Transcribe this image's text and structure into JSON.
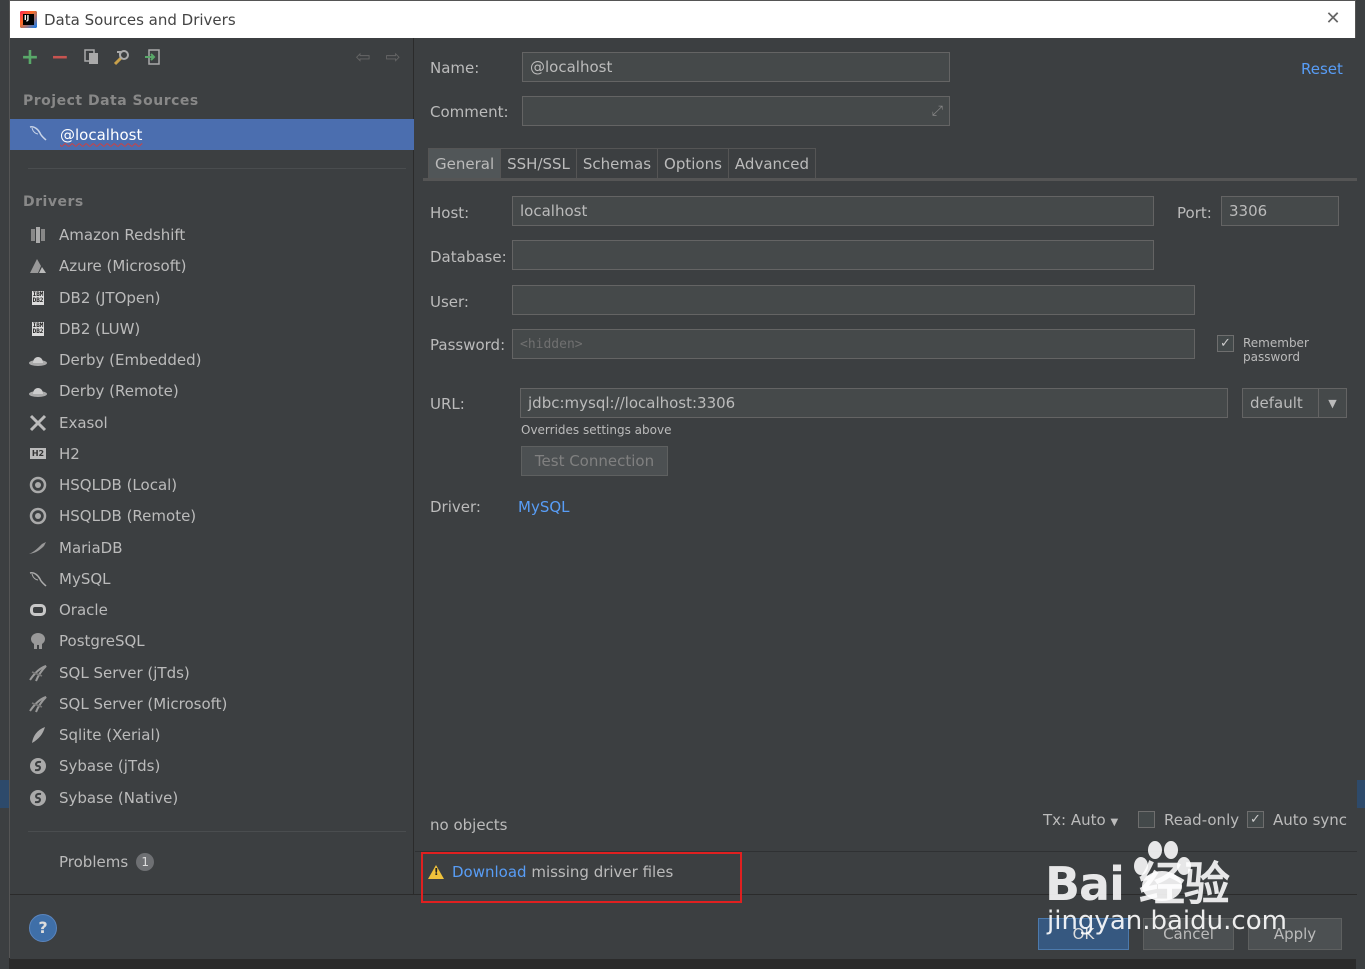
{
  "window": {
    "title": "Data Sources and Drivers"
  },
  "left": {
    "project_heading": "Project Data Sources",
    "selected_source": "@localhost",
    "drivers_heading": "Drivers",
    "drivers": [
      {
        "label": "Amazon Redshift",
        "icon": "redshift-icon"
      },
      {
        "label": "Azure (Microsoft)",
        "icon": "azure-icon"
      },
      {
        "label": "DB2 (JTOpen)",
        "icon": "ibm-db2-icon"
      },
      {
        "label": "DB2 (LUW)",
        "icon": "ibm-db2-icon"
      },
      {
        "label": "Derby (Embedded)",
        "icon": "derby-hat-icon"
      },
      {
        "label": "Derby (Remote)",
        "icon": "derby-hat-icon"
      },
      {
        "label": "Exasol",
        "icon": "exasol-x-icon"
      },
      {
        "label": "H2",
        "icon": "h2-icon"
      },
      {
        "label": "HSQLDB (Local)",
        "icon": "hsqldb-icon"
      },
      {
        "label": "HSQLDB (Remote)",
        "icon": "hsqldb-icon"
      },
      {
        "label": "MariaDB",
        "icon": "mariadb-seal-icon"
      },
      {
        "label": "MySQL",
        "icon": "mysql-dolphin-icon"
      },
      {
        "label": "Oracle",
        "icon": "oracle-icon"
      },
      {
        "label": "PostgreSQL",
        "icon": "postgresql-elephant-icon"
      },
      {
        "label": "SQL Server (jTds)",
        "icon": "sqlserver-icon"
      },
      {
        "label": "SQL Server (Microsoft)",
        "icon": "sqlserver-icon"
      },
      {
        "label": "Sqlite (Xerial)",
        "icon": "sqlite-feather-icon"
      },
      {
        "label": "Sybase (jTds)",
        "icon": "sybase-icon"
      },
      {
        "label": "Sybase (Native)",
        "icon": "sybase-icon"
      }
    ],
    "problems_label": "Problems",
    "problems_count": "1"
  },
  "form": {
    "name_label": "Name:",
    "name_value": "@localhost",
    "reset_label": "Reset",
    "comment_label": "Comment:",
    "comment_value": "",
    "tabs": [
      "General",
      "SSH/SSL",
      "Schemas",
      "Options",
      "Advanced"
    ],
    "host_label": "Host:",
    "host_value": "localhost",
    "port_label": "Port:",
    "port_value": "3306",
    "database_label": "Database:",
    "database_value": "",
    "user_label": "User:",
    "user_value": "",
    "password_label": "Password:",
    "password_placeholder": "<hidden>",
    "remember_password": "Remember password",
    "url_label": "URL:",
    "url_value": "jdbc:mysql://localhost:3306",
    "url_mode": "default",
    "overrides_note": "Overrides settings above",
    "test_connection": "Test Connection",
    "driver_label": "Driver:",
    "driver_value": "MySQL"
  },
  "status": {
    "objects": "no objects",
    "tx": "Tx: Auto",
    "read_only": "Read-only",
    "auto_sync": "Auto sync",
    "download_link": "Download",
    "download_rest": " missing driver files"
  },
  "buttons": {
    "help": "?",
    "ok": "OK",
    "cancel": "Cancel",
    "apply": "Apply"
  },
  "watermark": {
    "brand": "Bai  经验",
    "url": "jingyan.baidu.com"
  },
  "colors": {
    "accent": "#4b6eaf",
    "link": "#589df6",
    "highlight_box": "#e02020",
    "warning": "#f0c23b"
  }
}
